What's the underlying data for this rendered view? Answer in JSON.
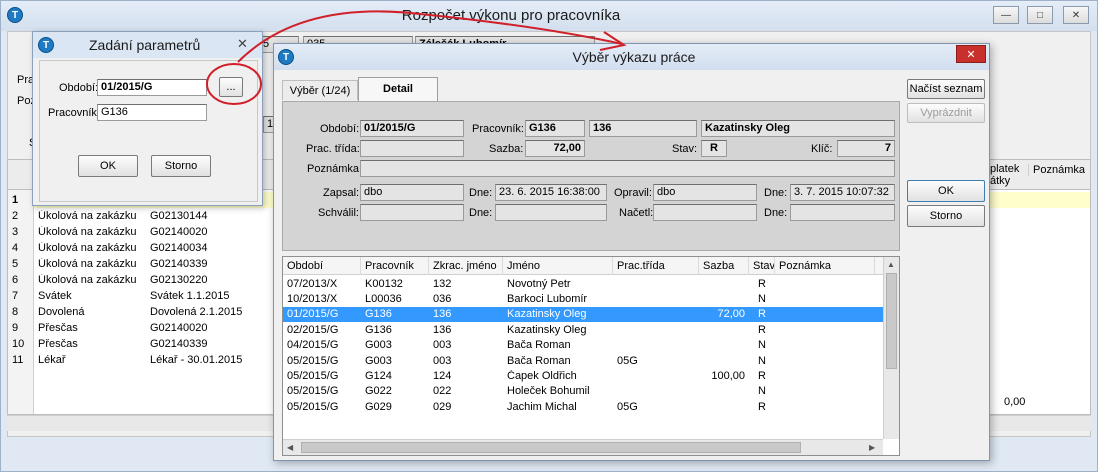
{
  "main_window": {
    "title": "Rozpočet výkonu pro pracovníka",
    "partial_field_a": "5",
    "partial_field_b": "035",
    "partial_name": "Zálešák Lubomír",
    "label_pra": "Pra",
    "label_poz": "Poz",
    "label_s": "S",
    "partial_16": "16",
    "col_platek": "platek\nátky",
    "col_poznamka": "Poznámka",
    "value_000": "0,00",
    "rows": [
      {
        "num": "1",
        "type": "",
        "code": ""
      },
      {
        "num": "2",
        "type": "Úkolová na zakázku",
        "code": "G02130144"
      },
      {
        "num": "3",
        "type": "Úkolová na zakázku",
        "code": "G02140020"
      },
      {
        "num": "4",
        "type": "Úkolová na zakázku",
        "code": "G02140034"
      },
      {
        "num": "5",
        "type": "Úkolová na zakázku",
        "code": "G02140339"
      },
      {
        "num": "6",
        "type": "Úkolová na zakázku",
        "code": "G02130220"
      },
      {
        "num": "7",
        "type": "Svátek",
        "code": "Svátek 1.1.2015"
      },
      {
        "num": "8",
        "type": "Dovolená",
        "code": "Dovolená 2.1.2015"
      },
      {
        "num": "9",
        "type": "Přesčas",
        "code": "G02140020"
      },
      {
        "num": "10",
        "type": "Přesčas",
        "code": "G02140339"
      },
      {
        "num": "11",
        "type": "Lékař",
        "code": "Lékař - 30.01.2015"
      }
    ]
  },
  "params_dialog": {
    "title": "Zadání parametrů",
    "period_label": "Období:",
    "period_value": "01/2015/G",
    "worker_label": "Pracovník",
    "worker_value": "G136",
    "browse_label": "...",
    "ok_label": "OK",
    "cancel_label": "Storno"
  },
  "report_dialog": {
    "title": "Výběr výkazu práce",
    "tab_select": "Výběr (1/24)",
    "tab_detail": "Detail",
    "load_label": "Načíst seznam",
    "clear_label": "Vyprázdnit",
    "ok_label": "OK",
    "cancel_label": "Storno",
    "detail": {
      "period_label": "Období:",
      "period_value": "01/2015/G",
      "worker_label": "Pracovník:",
      "worker_code": "G136",
      "worker_short": "136",
      "worker_name": "Kazatinsky Oleg",
      "class_label": "Prac. třída:",
      "class_value": "",
      "rate_label": "Sazba:",
      "rate_value": "72,00",
      "state_label": "Stav:",
      "state_value": "R",
      "key_label": "Klíč:",
      "key_value": "7",
      "note_label": "Poznámka:",
      "note_value": "",
      "wrote_label": "Zapsal:",
      "wrote_value": "dbo",
      "day_label": "Dne:",
      "wrote_date": "23. 6. 2015 16:38:00",
      "fixed_label": "Opravil:",
      "fixed_value": "dbo",
      "fixed_date": "3. 7. 2015 10:07:32",
      "approved_label": "Schválil:",
      "approved_value": "",
      "approved_date": "",
      "read_label": "Načetl:",
      "read_value": "",
      "read_date": ""
    },
    "table": {
      "headers": [
        "Období",
        "Pracovník",
        "Zkrac. jméno",
        "Jméno",
        "Prac.třída",
        "Sazba",
        "Stav",
        "Poznámka"
      ],
      "rows": [
        {
          "period": "07/2013/X",
          "worker": "K00132",
          "short": "132",
          "name": "Novotný Petr",
          "class": "",
          "rate": "",
          "state": "R",
          "selected": false
        },
        {
          "period": "10/2013/X",
          "worker": "L00036",
          "short": "036",
          "name": "Barkoci Lubomír",
          "class": "",
          "rate": "",
          "state": "N",
          "selected": false
        },
        {
          "period": "01/2015/G",
          "worker": "G136",
          "short": "136",
          "name": "Kazatinsky Oleg",
          "class": "",
          "rate": "72,00",
          "state": "R",
          "selected": true
        },
        {
          "period": "02/2015/G",
          "worker": "G136",
          "short": "136",
          "name": "Kazatinsky Oleg",
          "class": "",
          "rate": "",
          "state": "R",
          "selected": false
        },
        {
          "period": "04/2015/G",
          "worker": "G003",
          "short": "003",
          "name": "Bača Roman",
          "class": "",
          "rate": "",
          "state": "N",
          "selected": false
        },
        {
          "period": "05/2015/G",
          "worker": "G003",
          "short": "003",
          "name": "Bača Roman",
          "class": "05G",
          "rate": "",
          "state": "N",
          "selected": false
        },
        {
          "period": "05/2015/G",
          "worker": "G124",
          "short": "124",
          "name": "Čapek Oldřich",
          "class": "",
          "rate": "100,00",
          "state": "R",
          "selected": false
        },
        {
          "period": "05/2015/G",
          "worker": "G022",
          "short": "022",
          "name": "Holeček Bohumil",
          "class": "",
          "rate": "",
          "state": "N",
          "selected": false
        },
        {
          "period": "05/2015/G",
          "worker": "G029",
          "short": "029",
          "name": "Jachim Michal",
          "class": "05G",
          "rate": "",
          "state": "R",
          "selected": false
        }
      ]
    }
  },
  "colors": {
    "selection": "#3399ff",
    "highlight_row": "#ffffcc",
    "annotation": "#d0202a",
    "title_bar": "#dbe6f4"
  }
}
